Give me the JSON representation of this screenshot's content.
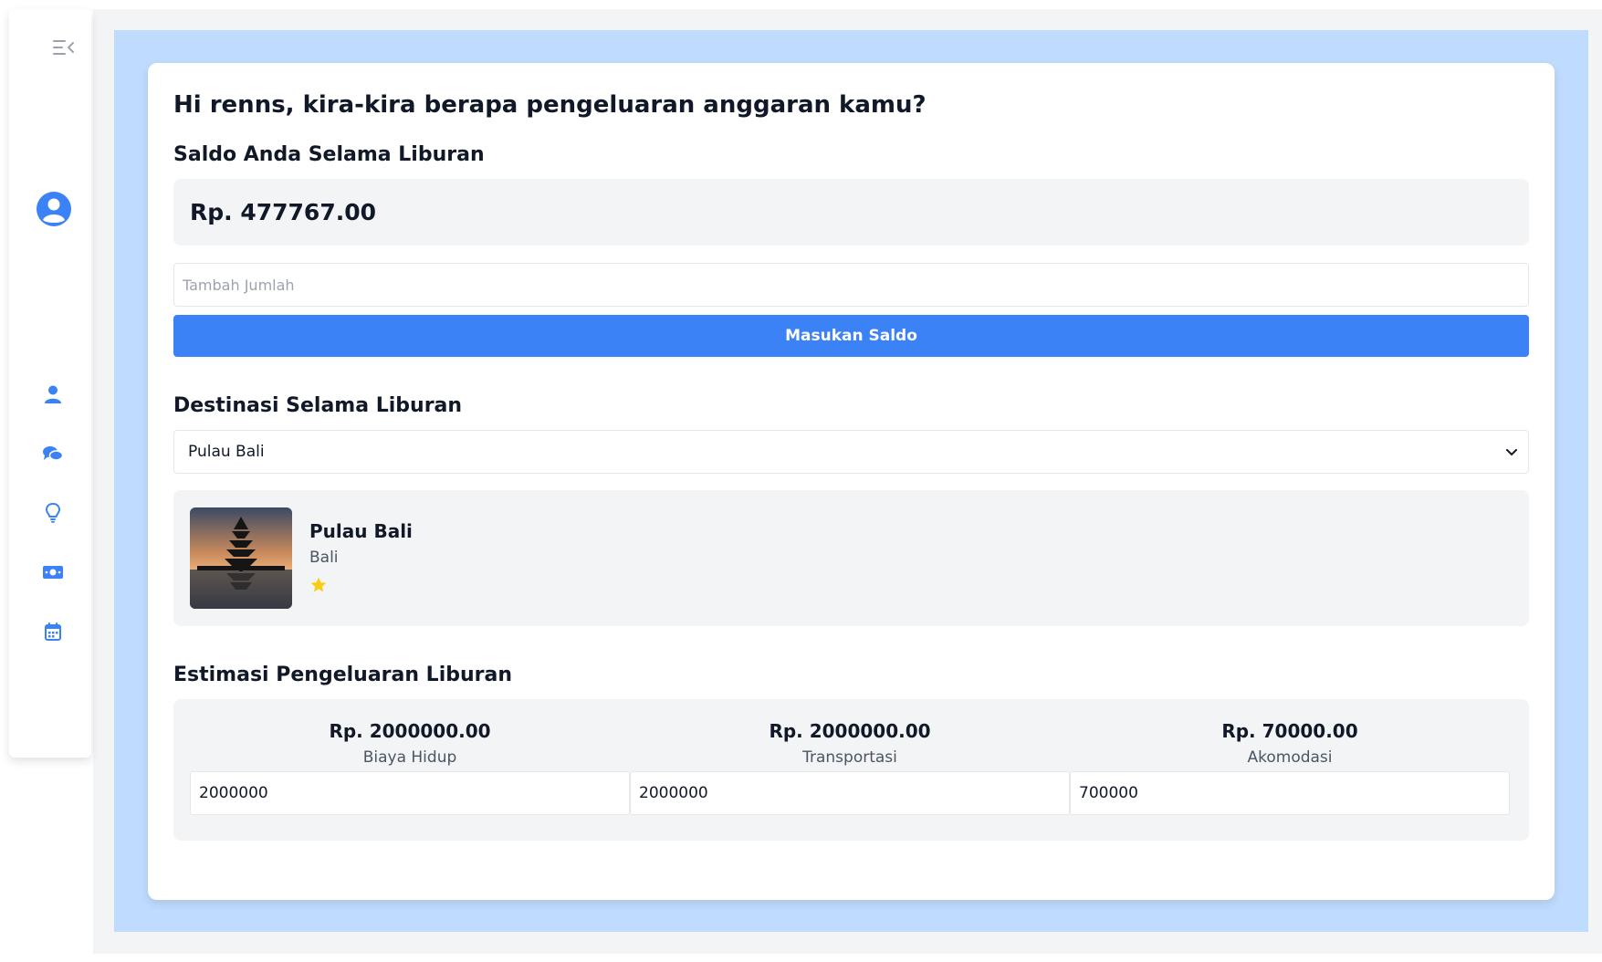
{
  "sidebar": {
    "toggle_icon": "menu-collapse-icon",
    "avatar_icon": "user-circle-icon",
    "nav_icons": [
      "user-icon",
      "comments-icon",
      "lightbulb-icon",
      "money-icon",
      "calendar-icon"
    ],
    "accent_color": "#3b82f6"
  },
  "main": {
    "title": "Hi renns, kira-kira berapa pengeluaran anggaran kamu?",
    "saldo": {
      "label": "Saldo Anda Selama Liburan",
      "amount": "Rp. 477767.00",
      "input_placeholder": "Tambah Jumlah",
      "button_label": "Masukan Saldo"
    },
    "destination": {
      "label": "Destinasi Selama Liburan",
      "selected": "Pulau Bali",
      "card": {
        "name": "Pulau Bali",
        "region": "Bali",
        "rating_stars": 1
      }
    },
    "estimate": {
      "label": "Estimasi Pengeluaran Liburan",
      "items": [
        {
          "amount": "Rp. 2000000.00",
          "name": "Biaya Hidup",
          "value": "2000000"
        },
        {
          "amount": "Rp. 2000000.00",
          "name": "Transportasi",
          "value": "2000000"
        },
        {
          "amount": "Rp. 70000.00",
          "name": "Akomodasi",
          "value": "700000"
        }
      ]
    }
  },
  "colors": {
    "frame": "#bfdbfe",
    "button": "#3b82f6",
    "star": "#facc15"
  }
}
